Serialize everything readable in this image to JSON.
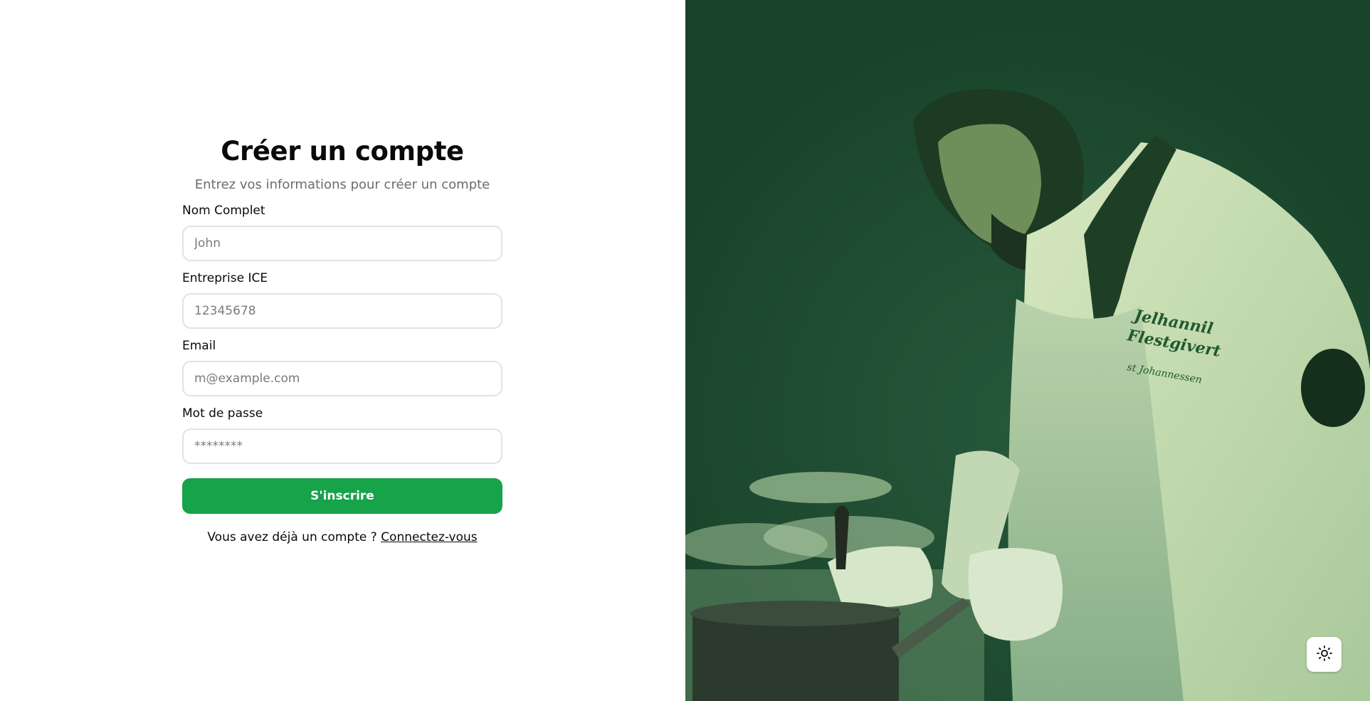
{
  "form": {
    "title": "Créer un compte",
    "subtitle": "Entrez vos informations pour créer un compte",
    "fields": [
      {
        "label": "Nom Complet",
        "placeholder": "John",
        "value": ""
      },
      {
        "label": "Entreprise ICE",
        "placeholder": "12345678",
        "value": ""
      },
      {
        "label": "Email",
        "placeholder": "m@example.com",
        "value": ""
      },
      {
        "label": "Mot de passe",
        "placeholder": "********",
        "value": ""
      }
    ],
    "submit_label": "S'inscrire",
    "footer_text": "Vous avez déjà un compte ?",
    "login_link": "Connectez-vous"
  },
  "hero": {
    "description": "chef in kitchen photo with green overlay"
  },
  "theme_toggle": {
    "icon": "sun-icon"
  },
  "colors": {
    "accent": "#16a34a",
    "overlay": "#18432a"
  }
}
